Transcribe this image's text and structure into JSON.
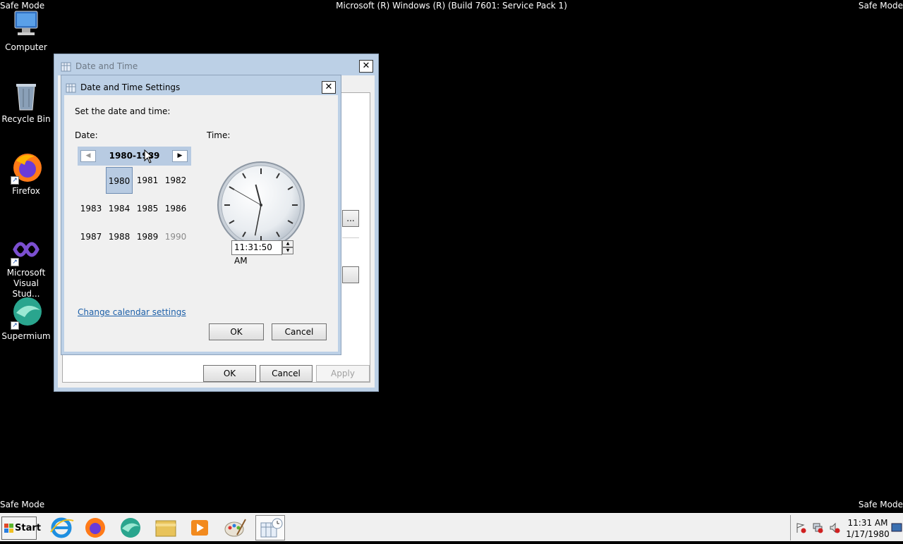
{
  "top_bar": {
    "safe_left": "Safe Mode",
    "build": "Microsoft (R) Windows (R) (Build 7601: Service Pack 1)",
    "safe_right": "Safe Mode"
  },
  "bottom_bar": {
    "safe_left": "Safe Mode",
    "safe_right": "Safe Mode"
  },
  "desktop_icons": [
    {
      "label": "Computer",
      "icon": "computer-icon"
    },
    {
      "label": "Recycle Bin",
      "icon": "recycle-bin-icon"
    },
    {
      "label": "Firefox",
      "icon": "firefox-icon"
    },
    {
      "label": "Microsoft Visual Stud...",
      "icon": "visual-studio-icon"
    },
    {
      "label": "Supermium",
      "icon": "supermium-icon"
    }
  ],
  "outer_window": {
    "title": "Date and Time",
    "ok": "OK",
    "cancel": "Cancel",
    "apply": "Apply",
    "partial_button": "..."
  },
  "inner_window": {
    "title": "Date and Time Settings",
    "instruction": "Set the date and time:",
    "date_label": "Date:",
    "time_label": "Time:",
    "calendar": {
      "decade": "1980-1989",
      "selected": "1980",
      "years": [
        "1980",
        "1981",
        "1982",
        "1983",
        "1984",
        "1985",
        "1986",
        "1987",
        "1988",
        "1989",
        "1990"
      ],
      "dimmed": [
        "1990"
      ]
    },
    "clock": {
      "hour": 11,
      "minute": 31,
      "second": 50
    },
    "time_value": "11:31:50 AM",
    "change_calendar_link": "Change calendar settings",
    "ok": "OK",
    "cancel": "Cancel"
  },
  "taskbar": {
    "start": "Start",
    "apps": [
      "internet-explorer-icon",
      "firefox-icon",
      "supermium-icon",
      "file-explorer-icon",
      "media-player-icon",
      "paint-icon",
      "date-time-icon"
    ],
    "time": "11:31 AM",
    "date": "1/17/1980"
  }
}
